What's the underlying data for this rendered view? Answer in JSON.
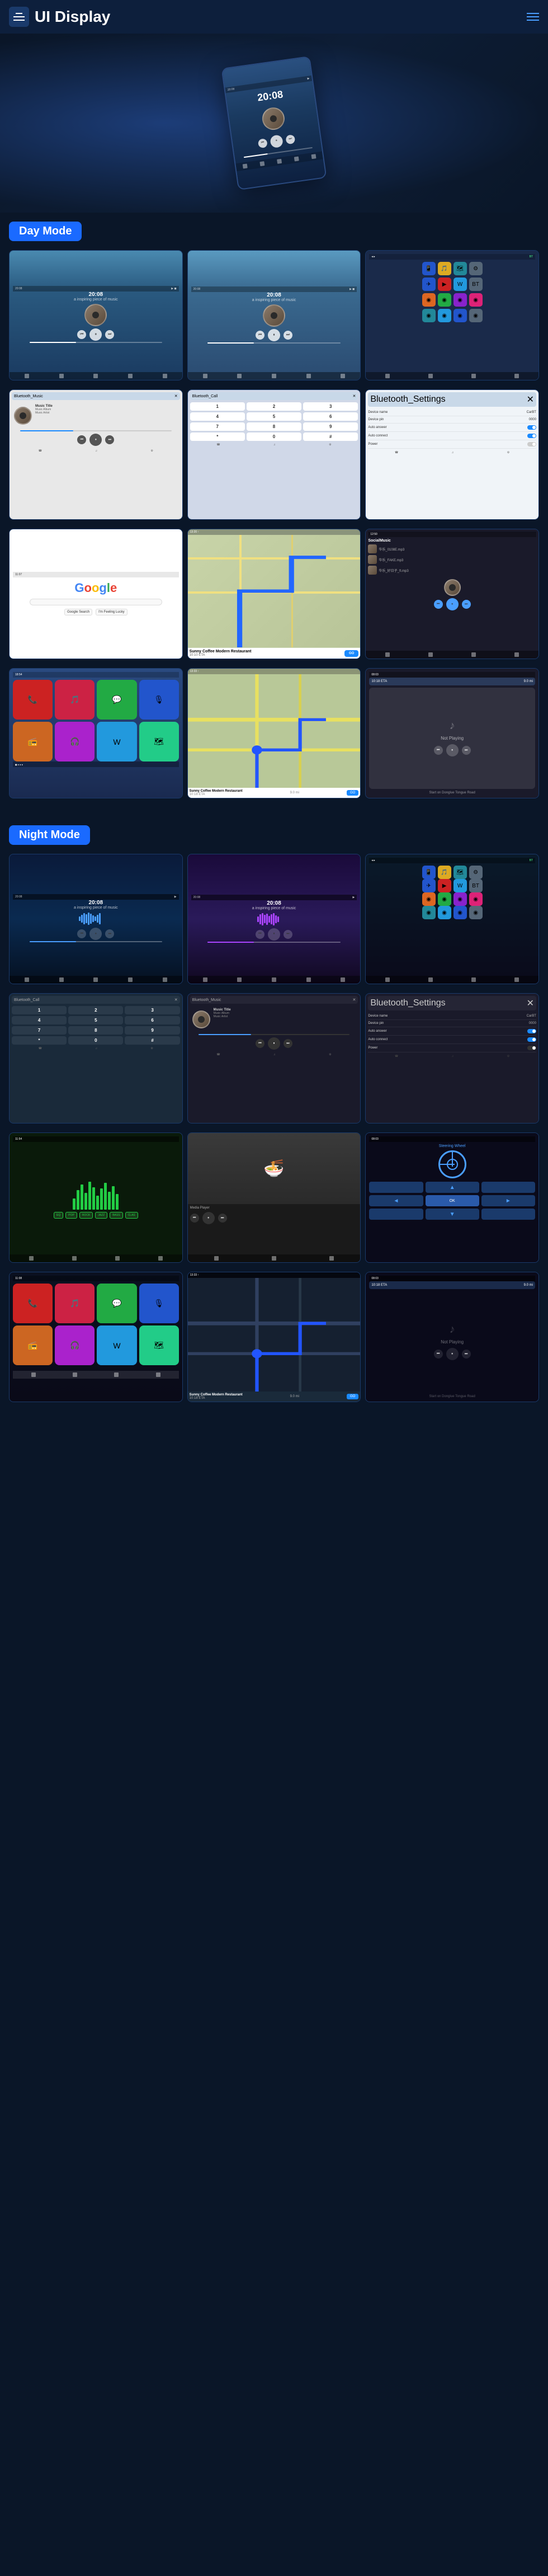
{
  "header": {
    "title": "UI Display",
    "menu_label": "menu",
    "hamburger_label": "navigation"
  },
  "day_mode": {
    "label": "Day Mode"
  },
  "night_mode": {
    "label": "Night Mode"
  },
  "music": {
    "time": "20:08",
    "subtitle": "a inspiring piece of music",
    "title": "Music Title",
    "album": "Music Album",
    "artist": "Music Artist"
  },
  "nav": {
    "cafe_name": "Sunny Coffee Modern Restaurant",
    "eta_label": "10:10 ETA",
    "go_label": "GO",
    "distance": "9.0 mi",
    "arrive_time": "10:18 ETA"
  },
  "settings": {
    "title": "Bluetooth_Settings",
    "device_name_label": "Device name",
    "device_name_value": "CarBT",
    "device_pin_label": "Device pin",
    "device_pin_value": "0000",
    "auto_answer_label": "Auto answer",
    "auto_connect_label": "Auto connect",
    "power_label": "Power"
  },
  "social": {
    "title": "SocialMusic",
    "items": [
      "华乐_0108E.mp3",
      "华乐_FAKE.mp3",
      "华乐_好日子_ft.mp3"
    ]
  },
  "not_playing": {
    "label": "Not Playing"
  },
  "route": {
    "label": "Start on Donglue Tongue Road"
  }
}
